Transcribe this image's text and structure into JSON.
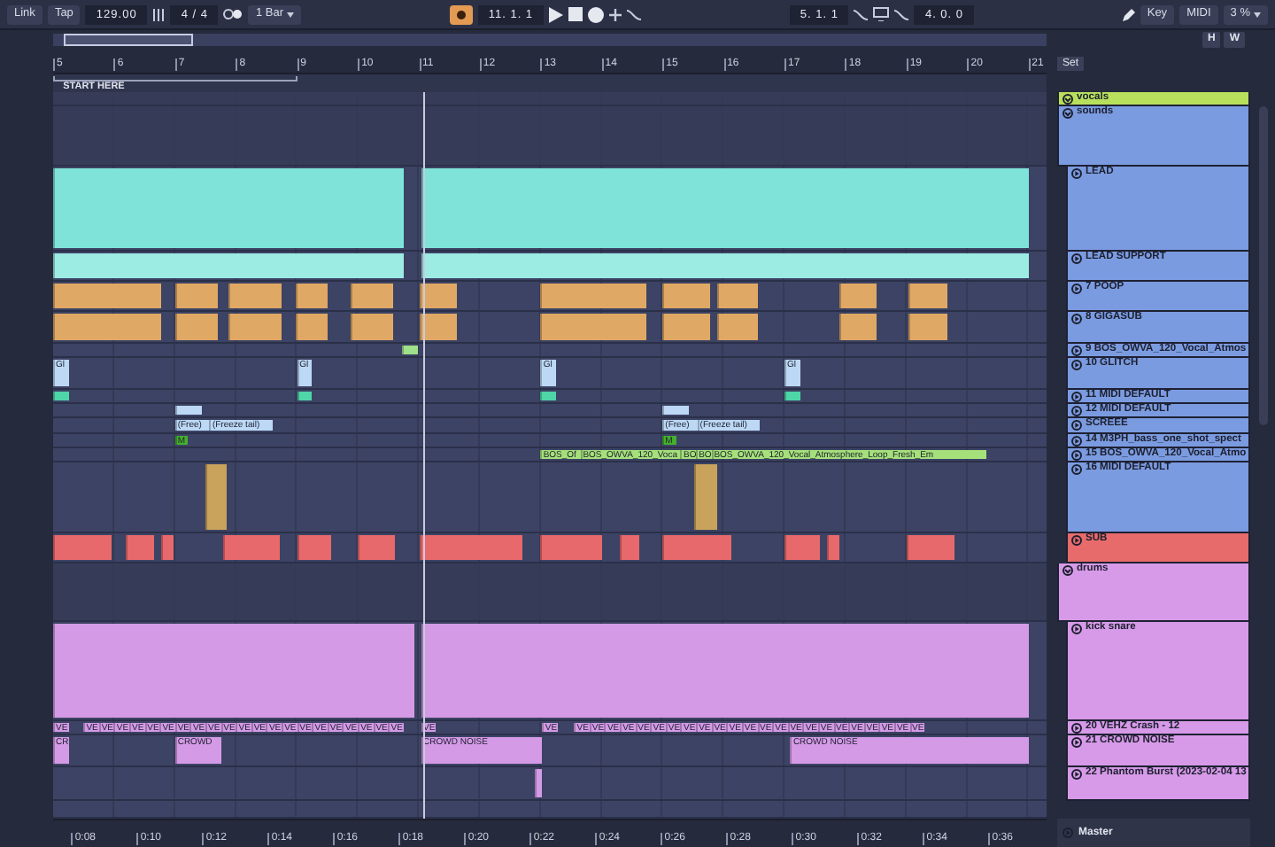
{
  "transport": {
    "link": "Link",
    "tap": "Tap",
    "tempo": "129.00",
    "signature": "4 / 4",
    "quantize": "1 Bar",
    "position": "11. 1. 1",
    "loop_start": "5. 1. 1",
    "loop_length": "4. 0. 0",
    "key": "Key",
    "midi": "MIDI",
    "cpu": "3 %"
  },
  "overview": {
    "buttons": [
      "H",
      "W"
    ]
  },
  "ruler": {
    "bars": [
      "5",
      "6",
      "7",
      "8",
      "9",
      "10",
      "11",
      "12",
      "13",
      "14",
      "15",
      "16",
      "17",
      "18",
      "19",
      "20",
      "21"
    ]
  },
  "locator": {
    "label": "START HERE"
  },
  "set_label": "Set",
  "tracks": [
    {
      "name": "vocals",
      "kind": "group",
      "color": "#b8e05c"
    },
    {
      "name": "sounds",
      "kind": "group",
      "color": "#7b9be0"
    },
    {
      "name": "LEAD",
      "kind": "track",
      "color": "#7b9be0",
      "clips": [
        {
          "color": "#7fe3da"
        },
        {
          "color": "#7fe3da"
        }
      ]
    },
    {
      "name": "LEAD SUPPORT",
      "kind": "track",
      "color": "#7b9be0",
      "clips": [
        {
          "color": "#9cece4"
        },
        {
          "color": "#9cece4"
        }
      ]
    },
    {
      "name": "7 POOP",
      "kind": "track",
      "color": "#7b9be0",
      "clips": [
        {
          "color": "#e0a865"
        },
        {
          "color": "#e0a865"
        },
        {
          "color": "#e0a865"
        },
        {
          "color": "#e0a865"
        },
        {
          "color": "#e0a865"
        },
        {
          "color": "#e0a865"
        },
        {
          "color": "#e0a865"
        },
        {
          "color": "#e0a865"
        },
        {
          "color": "#e0a865"
        },
        {
          "color": "#e0a865"
        },
        {
          "color": "#e0a865"
        }
      ]
    },
    {
      "name": "8 GIGASUB",
      "kind": "track",
      "color": "#7b9be0",
      "clips": [
        {
          "color": "#e0a865"
        },
        {
          "color": "#e0a865"
        },
        {
          "color": "#e0a865"
        },
        {
          "color": "#e0a865"
        },
        {
          "color": "#e0a865"
        },
        {
          "color": "#e0a865"
        },
        {
          "color": "#e0a865"
        },
        {
          "color": "#e0a865"
        },
        {
          "color": "#e0a865"
        },
        {
          "color": "#e0a865"
        },
        {
          "color": "#e0a865"
        }
      ]
    },
    {
      "name": "9 BOS_OWVA_120_Vocal_Atmos",
      "kind": "track",
      "color": "#7b9be0",
      "clips": [
        {
          "color": "#9fe08a"
        }
      ]
    },
    {
      "name": "10 GLITCH",
      "kind": "track",
      "color": "#7b9be0",
      "clips": [
        {
          "name": "Gl",
          "color": "#bcd8f5"
        },
        {
          "name": "Gl",
          "color": "#bcd8f5"
        },
        {
          "name": "Gl",
          "color": "#bcd8f5"
        },
        {
          "name": "Gl",
          "color": "#bcd8f5"
        }
      ]
    },
    {
      "name": "11 MIDI DEFAULT",
      "kind": "track",
      "color": "#7b9be0",
      "clips": [
        {
          "color": "#4fd6a8"
        },
        {
          "color": "#4fd6a8"
        },
        {
          "color": "#4fd6a8"
        },
        {
          "color": "#4fd6a8"
        }
      ]
    },
    {
      "name": "12 MIDI DEFAULT",
      "kind": "track",
      "color": "#7b9be0",
      "clips": [
        {
          "color": "#bcd8f5"
        },
        {
          "color": "#bcd8f5"
        }
      ]
    },
    {
      "name": "SCREEE",
      "kind": "track",
      "color": "#7b9be0",
      "clips": [
        {
          "name": "(Free)",
          "color": "#bcd8f5"
        },
        {
          "name": "(Freeze tail)",
          "color": "#bcd8f5"
        },
        {
          "name": "(Free)",
          "color": "#bcd8f5"
        },
        {
          "name": "(Freeze tail)",
          "color": "#bcd8f5"
        }
      ]
    },
    {
      "name": "14 M3PH_bass_one_shot_spect",
      "kind": "track",
      "color": "#7b9be0",
      "clips": [
        {
          "name": "M",
          "color": "#45b02e"
        },
        {
          "name": "M",
          "color": "#45b02e"
        }
      ]
    },
    {
      "name": "15 BOS_OWVA_120_Vocal_Atmo",
      "kind": "track",
      "color": "#7b9be0",
      "clips": [
        {
          "name": "BOS_Of",
          "color": "#a5e07a"
        },
        {
          "name": "BOS_OWVA_120_Voca",
          "color": "#a5e07a"
        },
        {
          "name": "BO",
          "color": "#a5e07a"
        },
        {
          "name": "BO",
          "color": "#a5e07a"
        },
        {
          "name": "BOS_OWVA_120_Vocal_Atmosphere_Loop_Fresh_Em",
          "color": "#a5e07a"
        }
      ]
    },
    {
      "name": "16 MIDI DEFAULT",
      "kind": "track",
      "color": "#7b9be0",
      "clips": [
        {
          "color": "#c9a25b"
        },
        {
          "color": "#c9a25b"
        }
      ]
    },
    {
      "name": "SUB",
      "kind": "track",
      "color": "#e86b6b",
      "clips": [
        {
          "color": "#e8696b"
        },
        {
          "color": "#e8696b"
        },
        {
          "color": "#e8696b"
        },
        {
          "color": "#e8696b"
        },
        {
          "color": "#e8696b"
        },
        {
          "color": "#e8696b"
        },
        {
          "color": "#e8696b"
        },
        {
          "color": "#e8696b"
        },
        {
          "color": "#e8696b"
        },
        {
          "color": "#e8696b"
        },
        {
          "color": "#e8696b"
        },
        {
          "color": "#e8696b"
        },
        {
          "color": "#e8696b"
        }
      ]
    },
    {
      "name": "drums",
      "kind": "group",
      "color": "#d79ae8"
    },
    {
      "name": "kick snare",
      "kind": "track",
      "color": "#d79ae8",
      "clips": [
        {
          "color": "#d49ae6"
        },
        {
          "color": "#d49ae6"
        }
      ]
    },
    {
      "name": "20 VEHZ Crash - 12",
      "kind": "track",
      "color": "#d79ae8",
      "clips": [
        {
          "name": "VE",
          "color": "#d49ae6"
        },
        {
          "name": "VE",
          "color": "#d49ae6"
        },
        {
          "name": "VE",
          "color": "#d49ae6"
        },
        {
          "name": "VE",
          "color": "#d49ae6"
        },
        {
          "name": "VE",
          "color": "#d49ae6"
        },
        {
          "name": "VE",
          "color": "#d49ae6"
        },
        {
          "name": "VE",
          "color": "#d49ae6"
        },
        {
          "name": "VE",
          "color": "#d49ae6"
        },
        {
          "name": "VE",
          "color": "#d49ae6"
        },
        {
          "name": "VE",
          "color": "#d49ae6"
        },
        {
          "name": "VE",
          "color": "#d49ae6"
        },
        {
          "name": "VE",
          "color": "#d49ae6"
        },
        {
          "name": "VE",
          "color": "#d49ae6"
        },
        {
          "name": "VE",
          "color": "#d49ae6"
        },
        {
          "name": "VE",
          "color": "#d49ae6"
        },
        {
          "name": "VE",
          "color": "#d49ae6"
        },
        {
          "name": "VE",
          "color": "#d49ae6"
        },
        {
          "name": "VE",
          "color": "#d49ae6"
        },
        {
          "name": "VE",
          "color": "#d49ae6"
        },
        {
          "name": "VE",
          "color": "#d49ae6"
        },
        {
          "name": "VE",
          "color": "#d49ae6"
        },
        {
          "name": "VE",
          "color": "#d49ae6"
        },
        {
          "name": "VE",
          "color": "#d49ae6"
        },
        {
          "name": "VE",
          "color": "#d49ae6"
        },
        {
          "name": "VE",
          "color": "#d49ae6"
        },
        {
          "name": "VE",
          "color": "#d49ae6"
        },
        {
          "name": "VE",
          "color": "#d49ae6"
        },
        {
          "name": "VE",
          "color": "#d49ae6"
        },
        {
          "name": "VE",
          "color": "#d49ae6"
        },
        {
          "name": "VE",
          "color": "#d49ae6"
        },
        {
          "name": "VE",
          "color": "#d49ae6"
        },
        {
          "name": "VE",
          "color": "#d49ae6"
        },
        {
          "name": "VE",
          "color": "#d49ae6"
        },
        {
          "name": "VE",
          "color": "#d49ae6"
        },
        {
          "name": "VE",
          "color": "#d49ae6"
        },
        {
          "name": "VE",
          "color": "#d49ae6"
        },
        {
          "name": "VE",
          "color": "#d49ae6"
        },
        {
          "name": "VE",
          "color": "#d49ae6"
        },
        {
          "name": "VE",
          "color": "#d49ae6"
        },
        {
          "name": "VE",
          "color": "#d49ae6"
        },
        {
          "name": "VE",
          "color": "#d49ae6"
        },
        {
          "name": "VE",
          "color": "#d49ae6"
        },
        {
          "name": "VE",
          "color": "#d49ae6"
        },
        {
          "name": "VE",
          "color": "#d49ae6"
        },
        {
          "name": "VE",
          "color": "#d49ae6"
        },
        {
          "name": "VE",
          "color": "#d49ae6"
        },
        {
          "name": "VE",
          "color": "#d49ae6"
        }
      ]
    },
    {
      "name": "21 CROWD NOISE",
      "kind": "track",
      "color": "#d79ae8",
      "clips": [
        {
          "name": "CR",
          "color": "#d49ae6"
        },
        {
          "name": "CROWD",
          "color": "#d49ae6"
        },
        {
          "name": "CROWD NOISE",
          "color": "#d49ae6"
        },
        {
          "name": "CROWD NOISE",
          "color": "#d49ae6"
        }
      ]
    },
    {
      "name": "22 Phantom Burst (2023-02-04 13",
      "kind": "track",
      "color": "#d79ae8",
      "clips": [
        {
          "color": "#d49ae6"
        }
      ]
    }
  ],
  "master": {
    "name": "Master"
  },
  "time_ruler": [
    "0:08",
    "0:10",
    "0:12",
    "0:14",
    "0:16",
    "0:18",
    "0:20",
    "0:22",
    "0:24",
    "0:26",
    "0:28",
    "0:30",
    "0:32",
    "0:34",
    "0:36"
  ]
}
